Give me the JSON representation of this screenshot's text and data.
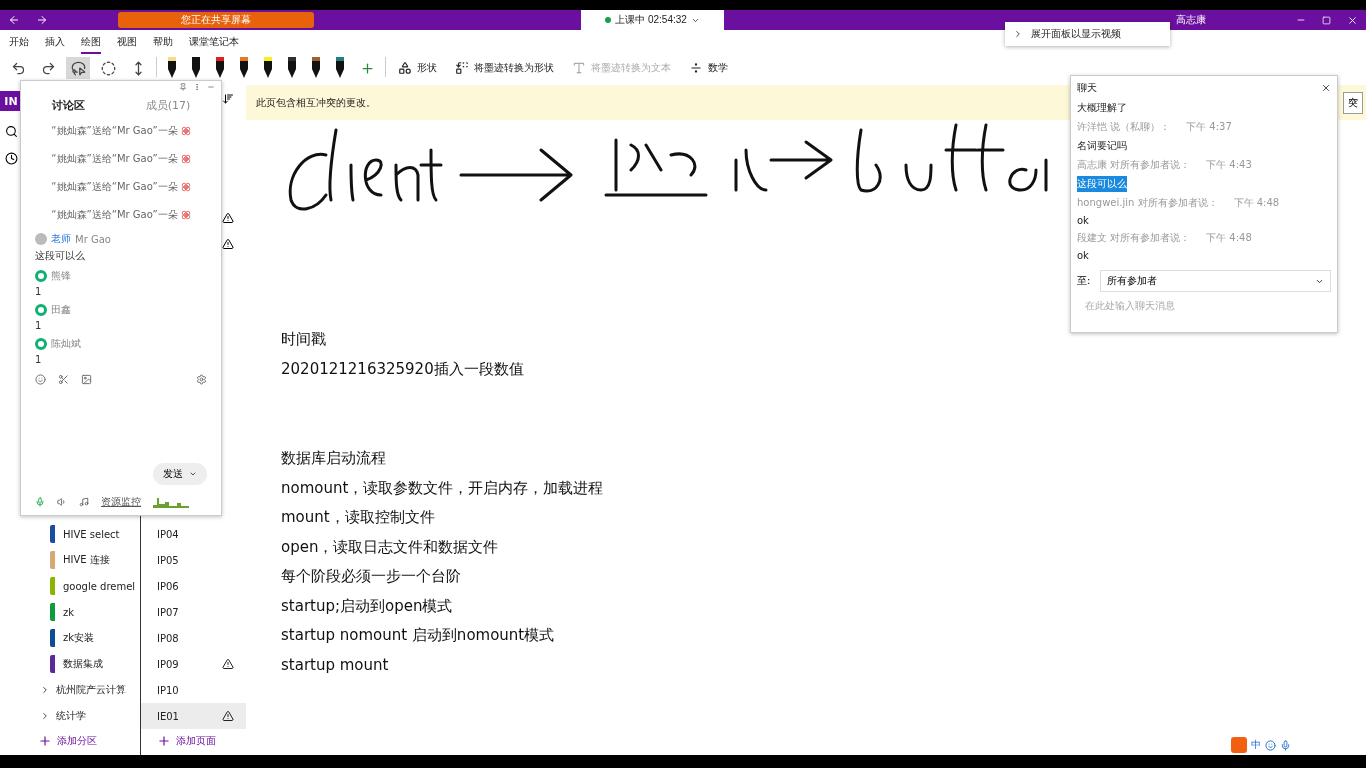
{
  "title_bar": {
    "sharing_banner": "您正在共享屏幕",
    "class_status": "上课中 02:54:32",
    "user_name": "高志康"
  },
  "ribbon_tabs": [
    {
      "label": "开始",
      "selected": false
    },
    {
      "label": "插入",
      "selected": false
    },
    {
      "label": "绘图",
      "selected": true
    },
    {
      "label": "视图",
      "selected": false
    },
    {
      "label": "帮助",
      "selected": false
    },
    {
      "label": "课堂笔记本",
      "selected": false
    }
  ],
  "toolbar": {
    "lasso_selected": true,
    "pens": [
      {
        "color": "#f3dc8c"
      },
      {
        "color": "#111111"
      },
      {
        "color": "#e02020"
      },
      {
        "color": "#e87820"
      },
      {
        "color": "#f5f020"
      },
      {
        "color": "#303030"
      },
      {
        "color": "#a06030"
      },
      {
        "color": "#208080"
      }
    ],
    "actions": [
      {
        "kind": "shape",
        "label": "形状",
        "disabled": false
      },
      {
        "kind": "ink-to-shape",
        "label": "将墨迹转换为形状",
        "disabled": false
      },
      {
        "kind": "ink-to-text",
        "label": "将墨迹转换为文本",
        "disabled": true
      },
      {
        "kind": "math",
        "label": "数学",
        "disabled": false
      }
    ]
  },
  "video_popup": {
    "label": "展开面板以显示视频"
  },
  "notebook_badge": "IN",
  "sections": [
    {
      "label": "HIVE select",
      "color": "#1a4fa0"
    },
    {
      "label": "HIVE 连接",
      "color": "#d8a878"
    },
    {
      "label": "google dremel",
      "color": "#8ab400"
    },
    {
      "label": "zk",
      "color": "#109a40"
    },
    {
      "label": "zk安装",
      "color": "#0e4c96"
    },
    {
      "label": "数据集成",
      "color": "#5a2a9a"
    }
  ],
  "section_groups": [
    {
      "label": "杭州院产云计算",
      "expanded": false
    },
    {
      "label": "统计学",
      "expanded": false
    }
  ],
  "add_section": "添加分区",
  "pages_behind_panel": [
    {
      "conflict": true
    },
    {
      "conflict": true
    }
  ],
  "pages": [
    {
      "label": "IP04",
      "conflict": false,
      "selected": false
    },
    {
      "label": "IP05",
      "conflict": false,
      "selected": false
    },
    {
      "label": "IP06",
      "conflict": false,
      "selected": false
    },
    {
      "label": "IP07",
      "conflict": false,
      "selected": false
    },
    {
      "label": "IP08",
      "conflict": false,
      "selected": false
    },
    {
      "label": "IP09",
      "conflict": true,
      "selected": false
    },
    {
      "label": "IP10",
      "conflict": false,
      "selected": false
    },
    {
      "label": "IE01",
      "conflict": true,
      "selected": true
    }
  ],
  "add_page": "添加页面",
  "conflict_bar": {
    "message": "此页包含相互冲突的更改。",
    "button": "突"
  },
  "note_blocks": [
    {
      "lines": [
        "时间戳",
        "2020121216325920插入一段数值"
      ]
    },
    {
      "lines": [
        "数据库启动流程",
        "nomount，读取参数文件，开启内存，加载进程",
        "mount，读取控制文件",
        "open，读取日志文件和数据文件",
        "每个阶段必须一步一个台阶",
        "startup;启动到open模式",
        "startup nomount 启动到nomount模式",
        "startup mount"
      ]
    }
  ],
  "discussion": {
    "tabs": [
      {
        "label": "讨论区",
        "selected": true
      },
      {
        "label": "成员(17)",
        "selected": false
      }
    ],
    "gifts": [
      "“姚灿森”送给“Mr Gao”一朵",
      "“姚灿森”送给“Mr Gao”一朵",
      "“姚灿森”送给“Mr Gao”一朵",
      "“姚灿森”送给“Mr Gao”一朵"
    ],
    "messages": [
      {
        "kind": "teacher",
        "badge": "老师",
        "name": "Mr Gao",
        "text": "这段可以么"
      },
      {
        "kind": "student",
        "name": "熊锋",
        "text": "1"
      },
      {
        "kind": "student",
        "name": "田鑫",
        "text": "1"
      },
      {
        "kind": "student",
        "name": "陈灿斌",
        "text": "1"
      }
    ],
    "send": "发送",
    "monitor": "资源监控"
  },
  "chat": {
    "title": "聊天",
    "messages": [
      {
        "kind": "text",
        "text": "大概理解了",
        "selected": false
      },
      {
        "kind": "meta",
        "sender": "许洋恺 说（私聊）：",
        "time": "下午 4:37"
      },
      {
        "kind": "text",
        "text": "名词要记吗",
        "selected": false
      },
      {
        "kind": "meta",
        "sender": "高志康 对所有参加者说：",
        "time": "下午 4:43"
      },
      {
        "kind": "text",
        "text": "这段可以么",
        "selected": true
      },
      {
        "kind": "meta",
        "sender": "hongwei.jin 对所有参加者说：",
        "time": "下午 4:48"
      },
      {
        "kind": "text",
        "text": "ok",
        "selected": false
      },
      {
        "kind": "meta",
        "sender": "段建文 对所有参加者说：",
        "time": "下午 4:48"
      },
      {
        "kind": "text",
        "text": "ok",
        "selected": false
      }
    ],
    "to_label": "至:",
    "to_value": "所有参加者",
    "placeholder": "在此处输入聊天消息"
  },
  "ime": {
    "mode": "中"
  }
}
